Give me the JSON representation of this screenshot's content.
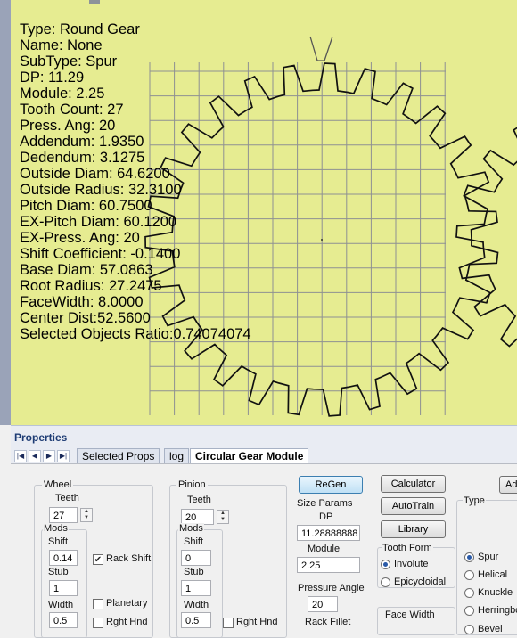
{
  "canvas": {
    "info_lines": [
      "Type: Round Gear",
      "Name: None",
      "SubType: Spur",
      "DP: 11.29",
      "Module: 2.25",
      "Tooth Count: 27",
      "Press. Ang: 20",
      "Addendum: 1.9350",
      "Dedendum: 3.1275",
      "Outside Diam: 64.6200",
      "Outside Radius: 32.3100",
      "Pitch Diam: 60.7500",
      "EX-Pitch Diam: 60.1200",
      "EX-Press. Ang: 20",
      "Shift Coefficient: -0.1400",
      "Base Diam: 57.0863",
      "Root Radius: 27.2475",
      "FaceWidth: 8.0000",
      "Center Dist:52.5600",
      "Selected Objects Ratio:0.74074074"
    ],
    "background_color": "#e6ec91",
    "grid_color": "#8e9093"
  },
  "properties": {
    "title": "Properties",
    "nav": [
      "first-icon",
      "prev-icon",
      "next-icon",
      "last-icon"
    ],
    "tabs": [
      "Selected Props",
      "log",
      "Circular Gear Module"
    ],
    "active_tab": "Circular Gear Module"
  },
  "wheel": {
    "group": "Wheel",
    "teeth_label": "Teeth",
    "teeth_value": "27",
    "mods_label": "Mods",
    "shift_label": "Shift",
    "shift_value": "0.14",
    "stub_label": "Stub",
    "stub_value": "1",
    "width_label": "Width",
    "width_value": "0.5",
    "rack_shift_label": "Rack Shift",
    "rack_shift_checked": true,
    "planetary_label": "Planetary",
    "planetary_checked": false,
    "right_hand_label": "Rght Hnd",
    "right_hand_checked": false
  },
  "pinion": {
    "group": "Pinion",
    "teeth_label": "Teeth",
    "teeth_value": "20",
    "mods_label": "Mods",
    "shift_label": "Shift",
    "shift_value": "0",
    "stub_label": "Stub",
    "stub_value": "1",
    "width_label": "Width",
    "width_value": "0.5",
    "right_hand_label": "Rght Hnd",
    "right_hand_checked": false
  },
  "size_params": {
    "regen_label": "ReGen",
    "group": "Size Params",
    "dp_label": "DP",
    "dp_value": "11.28888888",
    "module_label": "Module",
    "module_value": "2.25",
    "pressure_angle_label": "Pressure Angle",
    "pressure_angle_value": "20",
    "rack_fillet_label": "Rack Fillet"
  },
  "tools": {
    "calculator_label": "Calculator",
    "autotrain_label": "AutoTrain",
    "library_label": "Library",
    "tooth_form_group": "Tooth Form",
    "involute_label": "Involute",
    "epicycloidal_label": "Epicycloidal",
    "selected_form": "Involute",
    "face_width_label": "Face Width"
  },
  "type_group": {
    "group": "Type",
    "add_label": "Add",
    "options": [
      "Spur",
      "Helical",
      "Knuckle",
      "Herringbone",
      "Bevel"
    ],
    "selected": "Spur"
  }
}
